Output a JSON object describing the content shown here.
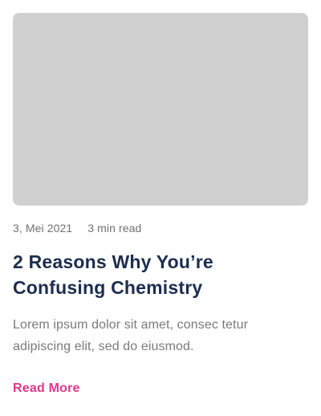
{
  "article": {
    "date": "3, Mei 2021",
    "read_time": "3 min read",
    "title": "2 Reasons Why You’re Confusing Chemistry",
    "excerpt": "Lorem ipsum dolor sit amet, consec tetur adipiscing elit, sed do eiusmod.",
    "read_more_label": "Read More"
  },
  "colors": {
    "title": "#1c2d4f",
    "accent": "#e0368d",
    "placeholder": "#d0d0d0",
    "muted_text": "#7a7a7a"
  }
}
